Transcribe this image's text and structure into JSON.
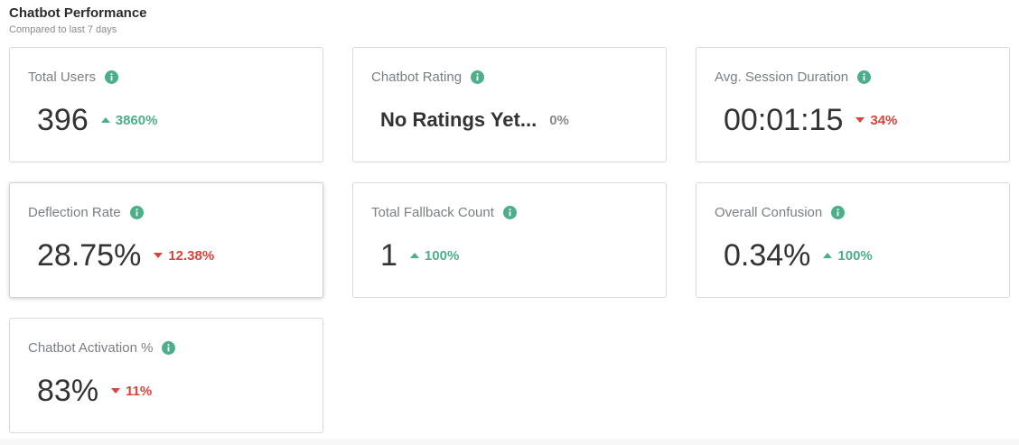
{
  "header": {
    "title": "Chatbot Performance",
    "subtitle": "Compared to last 7 days"
  },
  "colors": {
    "up": "#4caf8a",
    "down": "#d9433a",
    "info_icon": "#4caf8a"
  },
  "cards": [
    {
      "label": "Total Users",
      "value": "396",
      "change": "3860%",
      "direction": "up",
      "icon": "info-icon"
    },
    {
      "label": "Chatbot Rating",
      "value": "No Ratings Yet...",
      "change": "0%",
      "direction": "neutral",
      "icon": "info-icon"
    },
    {
      "label": "Avg. Session Duration",
      "value": "00:01:15",
      "change": "34%",
      "direction": "down",
      "icon": "info-icon"
    },
    {
      "label": "Deflection Rate",
      "value": "28.75%",
      "change": "12.38%",
      "direction": "down",
      "icon": "info-icon"
    },
    {
      "label": "Total Fallback Count",
      "value": "1",
      "change": "100%",
      "direction": "up",
      "icon": "info-icon"
    },
    {
      "label": "Overall Confusion",
      "value": "0.34%",
      "change": "100%",
      "direction": "up",
      "icon": "info-icon"
    },
    {
      "label": "Chatbot Activation %",
      "value": "83%",
      "change": "11%",
      "direction": "down",
      "icon": "info-icon"
    }
  ]
}
